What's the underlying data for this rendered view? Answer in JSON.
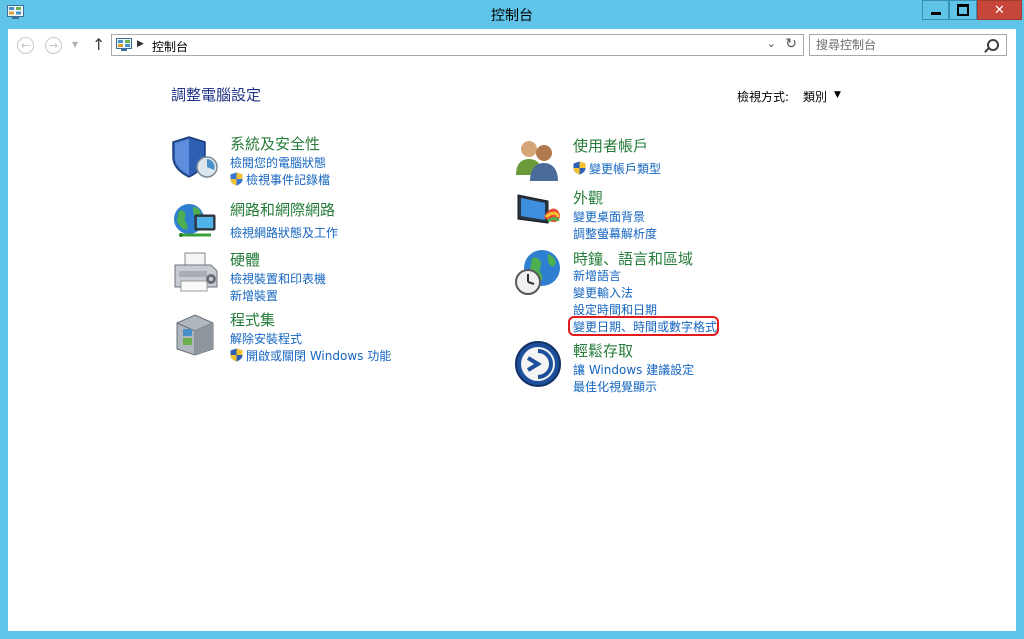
{
  "window": {
    "title": "控制台"
  },
  "toolbar": {
    "address_text": "控制台",
    "search_placeholder": "搜尋控制台"
  },
  "header": {
    "heading": "調整電腦設定",
    "view_by_label": "檢視方式:",
    "view_by_value": "類別"
  },
  "categories_left": [
    {
      "title": "系統及安全性",
      "links": [
        {
          "label": "檢閱您的電腦狀態",
          "shield": false
        },
        {
          "label": "檢視事件記錄檔",
          "shield": true
        }
      ]
    },
    {
      "title": "網路和網際網路",
      "links": [
        {
          "label": "檢視網路狀態及工作",
          "shield": false
        }
      ]
    },
    {
      "title": "硬體",
      "links": [
        {
          "label": "檢視裝置和印表機",
          "shield": false
        },
        {
          "label": "新增裝置",
          "shield": false
        }
      ]
    },
    {
      "title": "程式集",
      "links": [
        {
          "label": "解除安裝程式",
          "shield": false
        },
        {
          "label": "開啟或關閉 Windows 功能",
          "shield": true
        }
      ]
    }
  ],
  "categories_right": [
    {
      "title": "使用者帳戶",
      "links": [
        {
          "label": "變更帳戶類型",
          "shield": true
        }
      ]
    },
    {
      "title": "外觀",
      "links": [
        {
          "label": "變更桌面背景",
          "shield": false
        },
        {
          "label": "調整螢幕解析度",
          "shield": false
        }
      ]
    },
    {
      "title": "時鐘、語言和區域",
      "links": [
        {
          "label": "新增語言",
          "shield": false
        },
        {
          "label": "變更輸入法",
          "shield": false
        },
        {
          "label": "設定時間和日期",
          "shield": false
        },
        {
          "label": "變更日期、時間或數字格式",
          "shield": false,
          "highlighted": true
        }
      ]
    },
    {
      "title": "輕鬆存取",
      "links": [
        {
          "label": "讓 Windows 建議設定",
          "shield": false
        },
        {
          "label": "最佳化視覺顯示",
          "shield": false
        }
      ]
    }
  ],
  "colors": {
    "window_frame": "#5fc4e8",
    "category_title": "#267c3a",
    "link": "#1565c0",
    "heading": "#1e3287",
    "highlight": "#e21c1c"
  }
}
